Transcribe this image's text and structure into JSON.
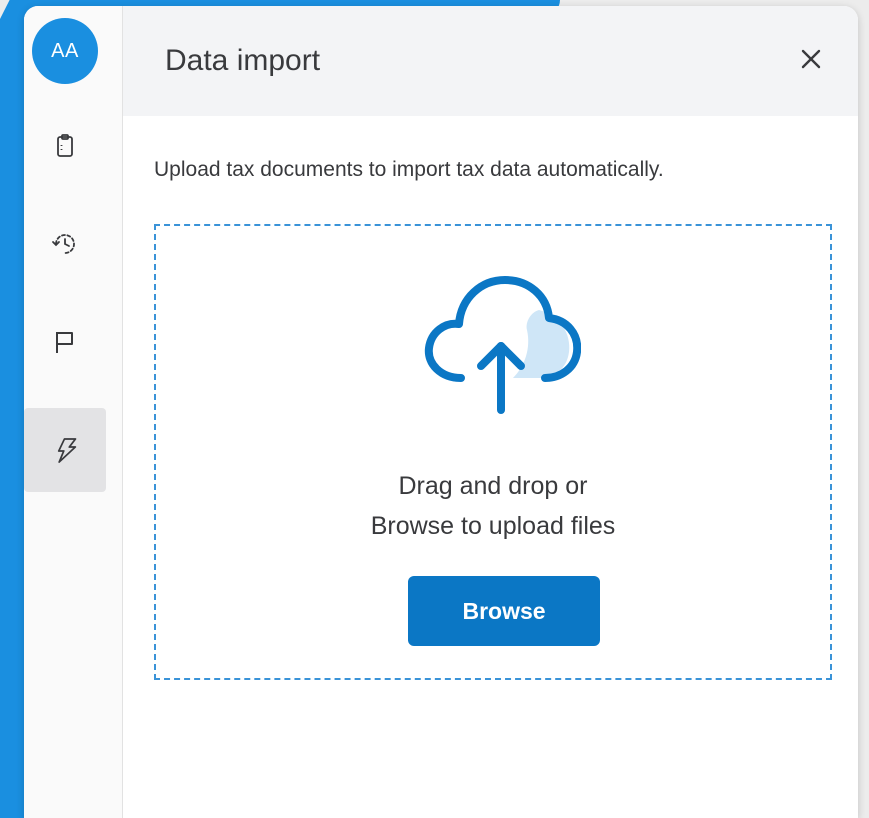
{
  "colors": {
    "accent": "#0b77c5",
    "background_shape": "#1a8fe0",
    "dashed_border": "#3a93d8"
  },
  "rail": {
    "avatar_initials": "AA",
    "items": [
      {
        "icon": "clipboard-icon"
      },
      {
        "icon": "history-icon"
      },
      {
        "icon": "flag-icon"
      },
      {
        "icon": "lightning-icon",
        "active": true
      }
    ]
  },
  "panel": {
    "title": "Data import",
    "close_icon": "close-icon",
    "description": "Upload tax documents to import tax data automatically.",
    "dropzone": {
      "icon": "cloud-upload-icon",
      "line1": "Drag and drop or",
      "line2": "Browse to upload files",
      "button_label": "Browse"
    }
  }
}
